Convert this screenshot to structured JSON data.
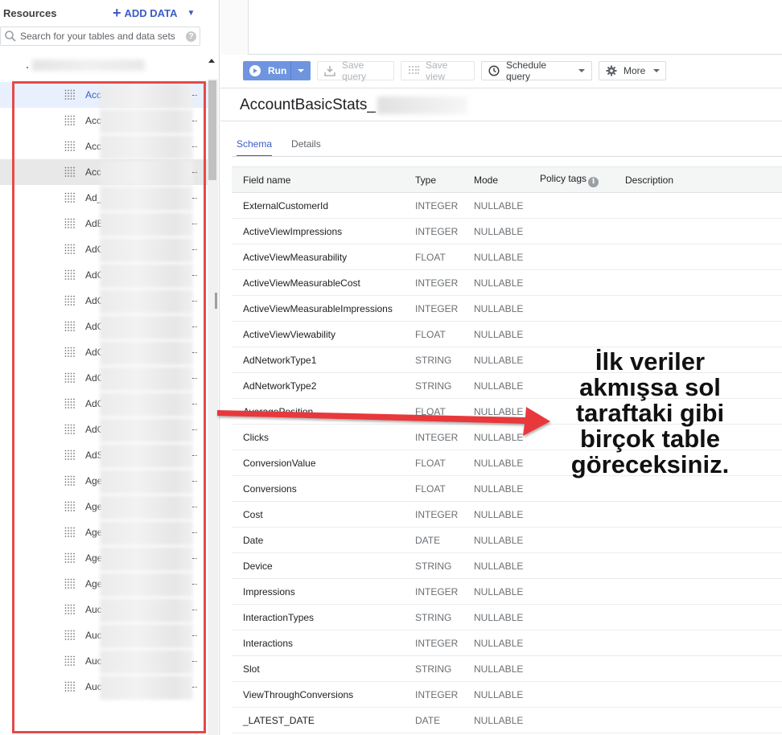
{
  "resources": {
    "title": "Resources",
    "add_data_label": "ADD DATA",
    "search_placeholder": "Search for your tables and data sets",
    "icons": {
      "search": "search-icon",
      "help": "help-icon",
      "table": "table-icon",
      "add": "plus-icon",
      "dropdown": "caret-down-icon"
    },
    "tables": [
      {
        "label": "Acc",
        "state": "selected"
      },
      {
        "label": "Acc",
        "state": ""
      },
      {
        "label": "Acc",
        "state": ""
      },
      {
        "label": "Acc",
        "state": "hovered"
      },
      {
        "label": "Ad_",
        "state": ""
      },
      {
        "label": "AdE",
        "state": ""
      },
      {
        "label": "AdC",
        "state": ""
      },
      {
        "label": "AdC",
        "state": ""
      },
      {
        "label": "AdC",
        "state": ""
      },
      {
        "label": "AdC",
        "state": ""
      },
      {
        "label": "AdC",
        "state": ""
      },
      {
        "label": "AdC",
        "state": ""
      },
      {
        "label": "AdC",
        "state": ""
      },
      {
        "label": "AdC",
        "state": ""
      },
      {
        "label": "AdS",
        "state": ""
      },
      {
        "label": "Age",
        "state": ""
      },
      {
        "label": "Age",
        "state": ""
      },
      {
        "label": "Age",
        "state": ""
      },
      {
        "label": "Age",
        "state": ""
      },
      {
        "label": "Age",
        "state": ""
      },
      {
        "label": "Auc",
        "state": ""
      },
      {
        "label": "Auc",
        "state": ""
      },
      {
        "label": "Auc",
        "state": ""
      },
      {
        "label": "Auc",
        "state": ""
      }
    ]
  },
  "toolbar": {
    "run_label": "Run",
    "save_query_label": "Save query",
    "save_view_label": "Save view",
    "schedule_query_label": "Schedule query",
    "more_label": "More"
  },
  "table_view": {
    "title": "AccountBasicStats_",
    "tabs": [
      {
        "label": "Schema",
        "active": true
      },
      {
        "label": "Details",
        "active": false
      }
    ],
    "columns": [
      "Field name",
      "Type",
      "Mode",
      "Policy tags",
      "Description"
    ],
    "rows": [
      {
        "field": "ExternalCustomerId",
        "type": "INTEGER",
        "mode": "NULLABLE"
      },
      {
        "field": "ActiveViewImpressions",
        "type": "INTEGER",
        "mode": "NULLABLE"
      },
      {
        "field": "ActiveViewMeasurability",
        "type": "FLOAT",
        "mode": "NULLABLE"
      },
      {
        "field": "ActiveViewMeasurableCost",
        "type": "INTEGER",
        "mode": "NULLABLE"
      },
      {
        "field": "ActiveViewMeasurableImpressions",
        "type": "INTEGER",
        "mode": "NULLABLE"
      },
      {
        "field": "ActiveViewViewability",
        "type": "FLOAT",
        "mode": "NULLABLE"
      },
      {
        "field": "AdNetworkType1",
        "type": "STRING",
        "mode": "NULLABLE"
      },
      {
        "field": "AdNetworkType2",
        "type": "STRING",
        "mode": "NULLABLE"
      },
      {
        "field": "AveragePosition",
        "type": "FLOAT",
        "mode": "NULLABLE"
      },
      {
        "field": "Clicks",
        "type": "INTEGER",
        "mode": "NULLABLE"
      },
      {
        "field": "ConversionValue",
        "type": "FLOAT",
        "mode": "NULLABLE"
      },
      {
        "field": "Conversions",
        "type": "FLOAT",
        "mode": "NULLABLE"
      },
      {
        "field": "Cost",
        "type": "INTEGER",
        "mode": "NULLABLE"
      },
      {
        "field": "Date",
        "type": "DATE",
        "mode": "NULLABLE"
      },
      {
        "field": "Device",
        "type": "STRING",
        "mode": "NULLABLE"
      },
      {
        "field": "Impressions",
        "type": "INTEGER",
        "mode": "NULLABLE"
      },
      {
        "field": "InteractionTypes",
        "type": "STRING",
        "mode": "NULLABLE"
      },
      {
        "field": "Interactions",
        "type": "INTEGER",
        "mode": "NULLABLE"
      },
      {
        "field": "Slot",
        "type": "STRING",
        "mode": "NULLABLE"
      },
      {
        "field": "ViewThroughConversions",
        "type": "INTEGER",
        "mode": "NULLABLE"
      },
      {
        "field": "_LATEST_DATE",
        "type": "DATE",
        "mode": "NULLABLE"
      }
    ]
  },
  "annotation": {
    "lines": [
      "İlk veriler",
      "akmışsa sol",
      "taraftaki gibi",
      "birçok table",
      "göreceksiniz."
    ],
    "highlight_color": "#e34b4b"
  }
}
